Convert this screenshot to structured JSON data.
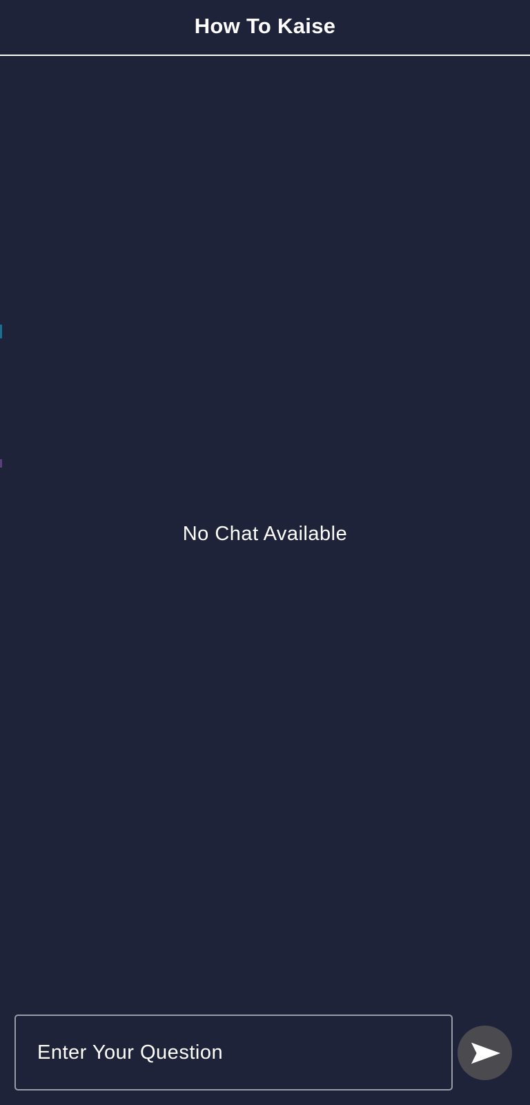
{
  "app": {
    "title": "How To Kaise"
  },
  "chat": {
    "empty_message": "No Chat Available"
  },
  "composer": {
    "value": "",
    "placeholder": "Enter Your Question"
  },
  "send": {
    "icon": "send-icon"
  },
  "colors": {
    "background": "#1f2339",
    "text": "#ffffff",
    "input_border": "#9a9ca8",
    "send_button": "#4a4a4f"
  }
}
